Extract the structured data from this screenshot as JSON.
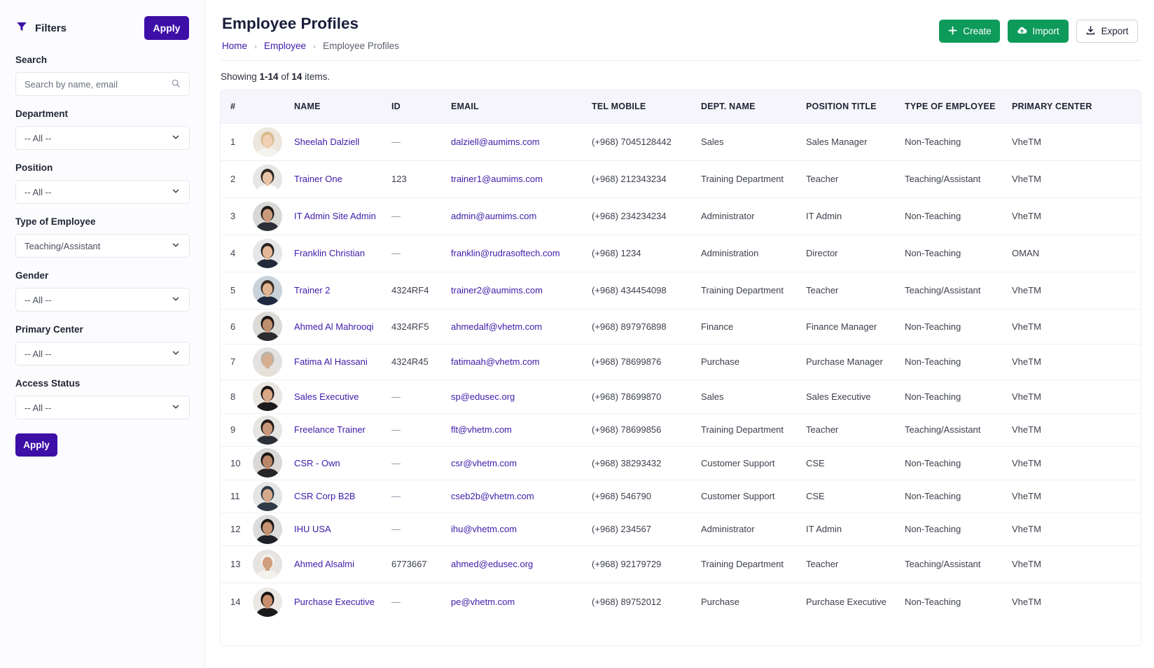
{
  "sidebar": {
    "title": "Filters",
    "apply_top_label": "Apply",
    "apply_bottom_label": "Apply",
    "search": {
      "label": "Search",
      "placeholder": "Search by name, email"
    },
    "filters": [
      {
        "label": "Department",
        "value": "-- All --"
      },
      {
        "label": "Position",
        "value": "-- All --"
      },
      {
        "label": "Type of Employee",
        "value": "Teaching/Assistant"
      },
      {
        "label": "Gender",
        "value": "-- All --"
      },
      {
        "label": "Primary Center",
        "value": "-- All --"
      },
      {
        "label": "Access Status",
        "value": "-- All --"
      }
    ]
  },
  "header": {
    "title": "Employee Profiles",
    "breadcrumb": [
      "Home",
      "Employee",
      "Employee Profiles"
    ],
    "actions": {
      "create": "Create",
      "import": "Import",
      "export": "Export"
    }
  },
  "summary": {
    "prefix": "Showing ",
    "range": "1-14",
    "middle": " of ",
    "total": "14",
    "suffix": " items."
  },
  "table": {
    "columns": [
      "#",
      "",
      "NAME",
      "ID",
      "EMAIL",
      "TEL MOBILE",
      "DEPT. NAME",
      "POSITION TITLE",
      "TYPE OF EMPLOYEE",
      "PRIMARY CENTER"
    ],
    "rows": [
      {
        "num": "1",
        "name": "Sheelah Dalziell",
        "id": "—",
        "email": "dalziell@aumims.com",
        "tel": "(+968) 7045128442",
        "dept": "Sales",
        "position": "Sales Manager",
        "type": "Non-Teaching",
        "center": "VheTM"
      },
      {
        "num": "2",
        "name": "Trainer One",
        "id": "123",
        "email": "trainer1@aumims.com",
        "tel": "(+968) 212343234",
        "dept": "Training Department",
        "position": "Teacher",
        "type": "Teaching/Assistant",
        "center": "VheTM"
      },
      {
        "num": "3",
        "name": "IT Admin Site Admin",
        "id": "—",
        "email": "admin@aumims.com",
        "tel": "(+968) 234234234",
        "dept": "Administrator",
        "position": "IT Admin",
        "type": "Non-Teaching",
        "center": "VheTM"
      },
      {
        "num": "4",
        "name": "Franklin Christian",
        "id": "—",
        "email": "franklin@rudrasoftech.com",
        "tel": "(+968) 1234",
        "dept": "Administration",
        "position": "Director",
        "type": "Non-Teaching",
        "center": "OMAN"
      },
      {
        "num": "5",
        "name": "Trainer 2",
        "id": "4324RF4",
        "email": "trainer2@aumims.com",
        "tel": "(+968) 434454098",
        "dept": "Training Department",
        "position": "Teacher",
        "type": "Teaching/Assistant",
        "center": "VheTM"
      },
      {
        "num": "6",
        "name": "Ahmed Al Mahrooqi",
        "id": "4324RF5",
        "email": "ahmedalf@vhetm.com",
        "tel": "(+968) 897976898",
        "dept": "Finance",
        "position": "Finance Manager",
        "type": "Non-Teaching",
        "center": "VheTM"
      },
      {
        "num": "7",
        "name": "Fatima Al Hassani",
        "id": "4324R45",
        "email": "fatimaah@vhetm.com",
        "tel": "(+968) 78699876",
        "dept": "Purchase",
        "position": "Purchase Manager",
        "type": "Non-Teaching",
        "center": "VheTM"
      },
      {
        "num": "8",
        "name": "Sales Executive",
        "id": "—",
        "email": "sp@edusec.org",
        "tel": "(+968) 78699870",
        "dept": "Sales",
        "position": "Sales Executive",
        "type": "Non-Teaching",
        "center": "VheTM"
      },
      {
        "num": "9",
        "name": "Freelance Trainer",
        "id": "—",
        "email": "flt@vhetm.com",
        "tel": "(+968) 78699856",
        "dept": "Training Department",
        "position": "Teacher",
        "type": "Teaching/Assistant",
        "center": "VheTM"
      },
      {
        "num": "10",
        "name": "CSR - Own",
        "id": "—",
        "email": "csr@vhetm.com",
        "tel": "(+968) 38293432",
        "dept": "Customer Support",
        "position": "CSE",
        "type": "Non-Teaching",
        "center": "VheTM"
      },
      {
        "num": "11",
        "name": "CSR Corp B2B",
        "id": "—",
        "email": "cseb2b@vhetm.com",
        "tel": "(+968) 546790",
        "dept": "Customer Support",
        "position": "CSE",
        "type": "Non-Teaching",
        "center": "VheTM"
      },
      {
        "num": "12",
        "name": "IHU USA",
        "id": "—",
        "email": "ihu@vhetm.com",
        "tel": "(+968) 234567",
        "dept": "Administrator",
        "position": "IT Admin",
        "type": "Non-Teaching",
        "center": "VheTM"
      },
      {
        "num": "13",
        "name": "Ahmed Alsalmi",
        "id": "6773667",
        "email": "ahmed@edusec.org",
        "tel": "(+968) 92179729",
        "dept": "Training Department",
        "position": "Teacher",
        "type": "Teaching/Assistant",
        "center": "VheTM"
      },
      {
        "num": "14",
        "name": "Purchase Executive",
        "id": "—",
        "email": "pe@vhetm.com",
        "tel": "(+968) 89752012",
        "dept": "Purchase",
        "position": "Purchase Executive",
        "type": "Non-Teaching",
        "center": "VheTM"
      }
    ]
  },
  "colors": {
    "primary": "#3d0fa6",
    "link": "#3d1aa8",
    "success": "#0e9a5a",
    "header_bg": "#f5f5fb"
  },
  "icons": {
    "filter": "filter-icon",
    "search": "search-icon",
    "chevron": "chevron-down-icon",
    "create": "plus-icon",
    "import": "cloud-upload-icon",
    "export": "download-icon",
    "avatar": "avatar-image"
  }
}
